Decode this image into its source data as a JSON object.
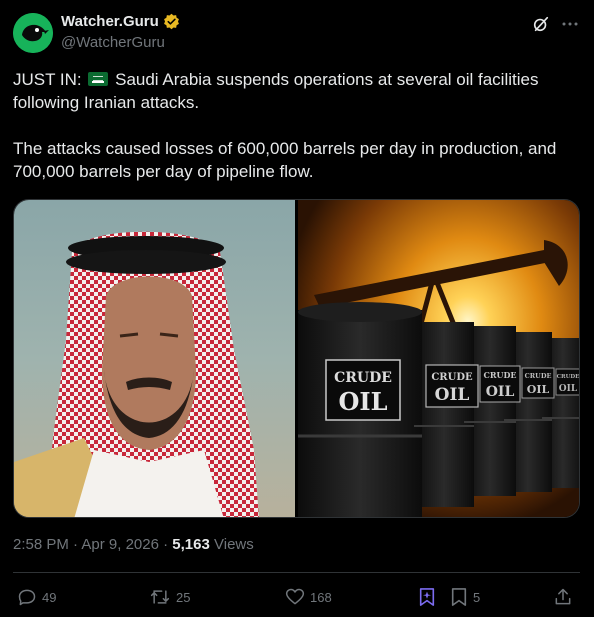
{
  "account": {
    "name": "Watcher.Guru",
    "handle": "@WatcherGuru"
  },
  "tweet": {
    "prefix": "JUST IN:",
    "line1_rest": "Saudi Arabia suspends operations at several oil facilities following Iranian attacks.",
    "paragraph2": "The attacks caused losses of 600,000 barrels per day in production, and 700,000 barrels per day of pipeline flow."
  },
  "media": {
    "barrel_label_top": "CRUDE",
    "barrel_label_bottom": "OIL"
  },
  "meta": {
    "time": "2:58 PM",
    "separator": "·",
    "date": "Apr 9, 2026",
    "views_count": "5,163",
    "views_label": "Views"
  },
  "actions": {
    "replies": "49",
    "reposts": "25",
    "likes": "168",
    "bookmarks": "5"
  },
  "icons": {
    "verified": "verified-badge-icon",
    "grok": "grok-icon",
    "more": "more-icon",
    "reply": "reply-icon",
    "repost": "repost-icon",
    "like": "heart-icon",
    "grok_action": "grok-action-icon",
    "bookmark": "bookmark-icon",
    "share": "share-icon"
  },
  "colors": {
    "background": "#000000",
    "text": "#e7e9ea",
    "muted": "#71767b",
    "border": "#2f3336",
    "avatar": "#17b35a",
    "verified": "#e8b923",
    "grok_accent": "#7c6cf0"
  }
}
